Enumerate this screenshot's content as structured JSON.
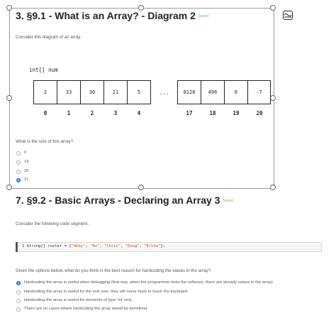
{
  "question3": {
    "title": "3. §9.1 - What is an Array? - Diagram 2",
    "saved": "Saved",
    "prompt": "Consider this diagram of an array.",
    "declaration": "int[] num",
    "cells": [
      "2",
      "33",
      "30",
      "21",
      "5",
      "...",
      "8128",
      "496",
      "6",
      "-7"
    ],
    "indices": [
      "0",
      "1",
      "2",
      "3",
      "4",
      "",
      "17",
      "18",
      "19",
      "20"
    ],
    "question": "What is the size of this array?",
    "options": [
      "0",
      "19",
      "20",
      "21"
    ],
    "selected_index": 3
  },
  "question7": {
    "title": "7. §9.2 - Basic Arrays - Declaring an Array 3",
    "saved": "Saved",
    "prompt": "Consider the following code segment.",
    "code": {
      "line_number": "1",
      "prefix": "String[] roster = {",
      "strings": [
        "\"Abby\"",
        "\"Bo\"",
        "\"Chris\"",
        "\"Doug\"",
        "\"Erika\""
      ],
      "suffix": "};"
    },
    "question": "Given the options below, what do you think is the best reason for hardcoding the values in the array?",
    "options": [
      "Hardcoding the array is useful when debugging (that way, when the programmer tests the software, there are already values in the array)",
      "Hardcoding the array is useful for the end user, they will never have to touch the keyboard",
      "Hardcoding the array is useful for elements of type 'int' only.",
      "There are no cases where hardcoding the array would be beneficial"
    ],
    "selected_index": 0
  },
  "colors": {
    "accent": "#2a6fdb",
    "saved": "#6bbf6b"
  }
}
